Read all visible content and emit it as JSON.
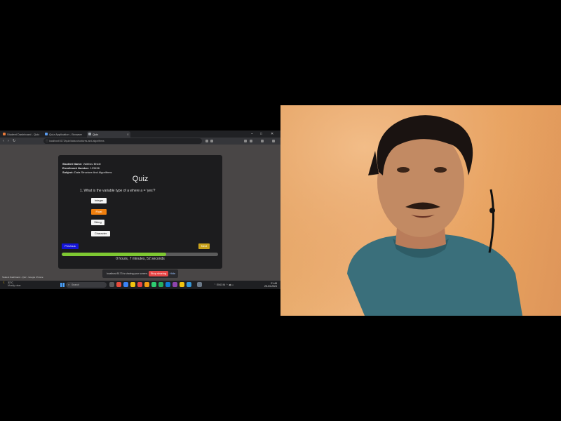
{
  "browser": {
    "tabs": [
      {
        "title": "Student Dashboard - Quiz"
      },
      {
        "title": "Quiz Application - Browser"
      },
      {
        "title": "Quiz",
        "active": true
      }
    ],
    "window_controls": [
      "–",
      "□",
      "✕"
    ],
    "url": "localhost:5173/quiz/data-structures-and-algorithms",
    "nav_icons": {
      "back": "‹",
      "forward": "›",
      "reload": "↻"
    }
  },
  "quiz": {
    "student_line": {
      "label": "Student Name:",
      "value": "Vaibhav Bhide"
    },
    "enrollment_line": {
      "label": "Enrollment Number:",
      "value": "123456"
    },
    "subject_line": {
      "label": "Subject:",
      "value": "Data Structure And Algorithms"
    },
    "title": "Quiz",
    "question": "1. What is the variable type of a where a = 'yes'?",
    "options": [
      "Integer",
      "Float",
      "String",
      "Character"
    ],
    "selected_index": 1,
    "prev_label": "Previous",
    "next_label": "Next",
    "progress": 0.67,
    "timer": "0 hours, 7 minutes, 52 seconds"
  },
  "share_bar": {
    "text": "localhost:5173 is sharing your screen.",
    "stop_label": "Stop sharing",
    "hide_label": "Hide"
  },
  "notification": "Student Dashboard - Quiz - Google Chrome",
  "taskbar": {
    "weather_temp": "31°C",
    "weather_desc": "Mostly clear",
    "search_placeholder": "Search",
    "tray_text": "ENG IN",
    "time": "21:48",
    "date": "25-03-2024"
  },
  "colors": {
    "selected_option": "#f07f0e",
    "previous_button": "#1414d6",
    "next_button": "#c9a21c",
    "progress_fill": "#7ec832",
    "stop_button": "#e84646"
  }
}
